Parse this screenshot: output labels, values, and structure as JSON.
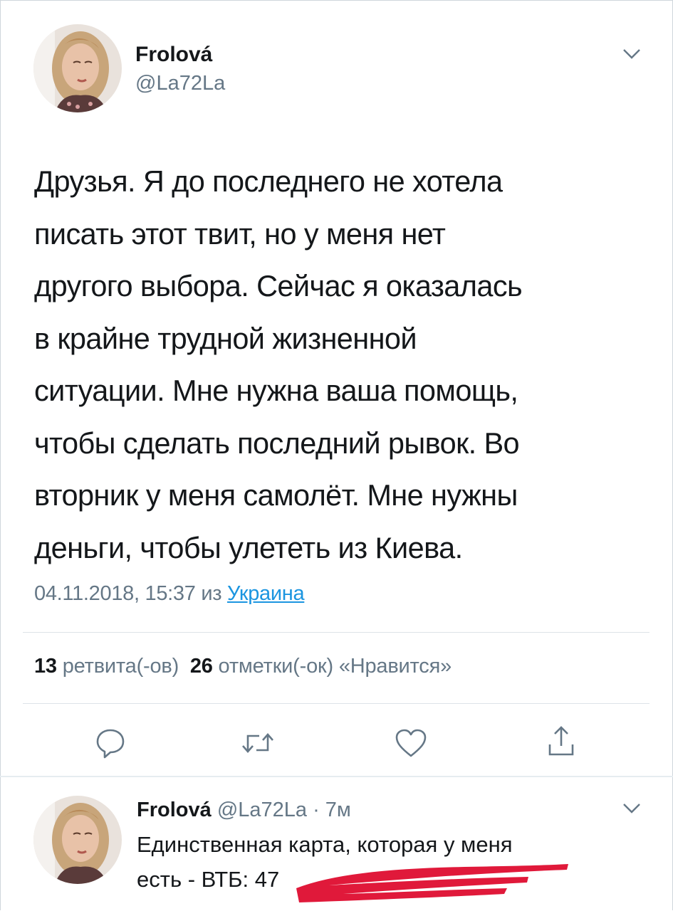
{
  "tweet": {
    "author_name": "Frolová",
    "author_handle": "@La72La",
    "text": "Друзья. Я до последнего не хотела\nписать этот твит, но у меня нет\nдругого выбора. Сейчас я оказалась\nв крайне трудной жизненной\nситуации. Мне нужна ваша помощь,\nчтобы сделать последний рывок. Во\nвторник у меня самолёт. Мне нужны\nденьги, чтобы улететь из Киева.",
    "timestamp": "04.11.2018, 15:37 из",
    "location": "Украина",
    "retweets_count": "13",
    "retweets_label": "ретвита(-ов)",
    "likes_count": "26",
    "likes_label": "отметки(-ок) «Нравится»"
  },
  "actions": {
    "reply_icon": "speech-bubble",
    "retweet_icon": "retweet-arrows",
    "like_icon": "heart",
    "share_icon": "share-arrow-up"
  },
  "reply": {
    "author_name": "Frolová",
    "meta": "@La72La · 7м",
    "text_line1": "Единственная карта, которая у меня",
    "text_line2": "есть - ВТБ: 47"
  },
  "colors": {
    "text": "#14171a",
    "secondary": "#657786",
    "link": "#1b95e0",
    "redaction": "#e0193a"
  }
}
